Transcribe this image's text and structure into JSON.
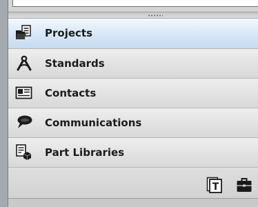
{
  "nav": {
    "items": [
      {
        "label": "Projects",
        "icon": "folder-documents-icon",
        "selected": true
      },
      {
        "label": "Standards",
        "icon": "compass-icon",
        "selected": false
      },
      {
        "label": "Contacts",
        "icon": "contact-card-icon",
        "selected": false
      },
      {
        "label": "Communications",
        "icon": "speech-bubble-icon",
        "selected": false
      },
      {
        "label": "Part Libraries",
        "icon": "part-library-icon",
        "selected": false
      }
    ]
  },
  "footer": {
    "buttons": [
      {
        "icon": "template-documents-icon",
        "glyph": "T"
      },
      {
        "icon": "briefcase-icon"
      }
    ]
  },
  "colors": {
    "selected_row": "#d9e8f8",
    "row": "#e4e4e4",
    "text": "#1b1b1b"
  }
}
